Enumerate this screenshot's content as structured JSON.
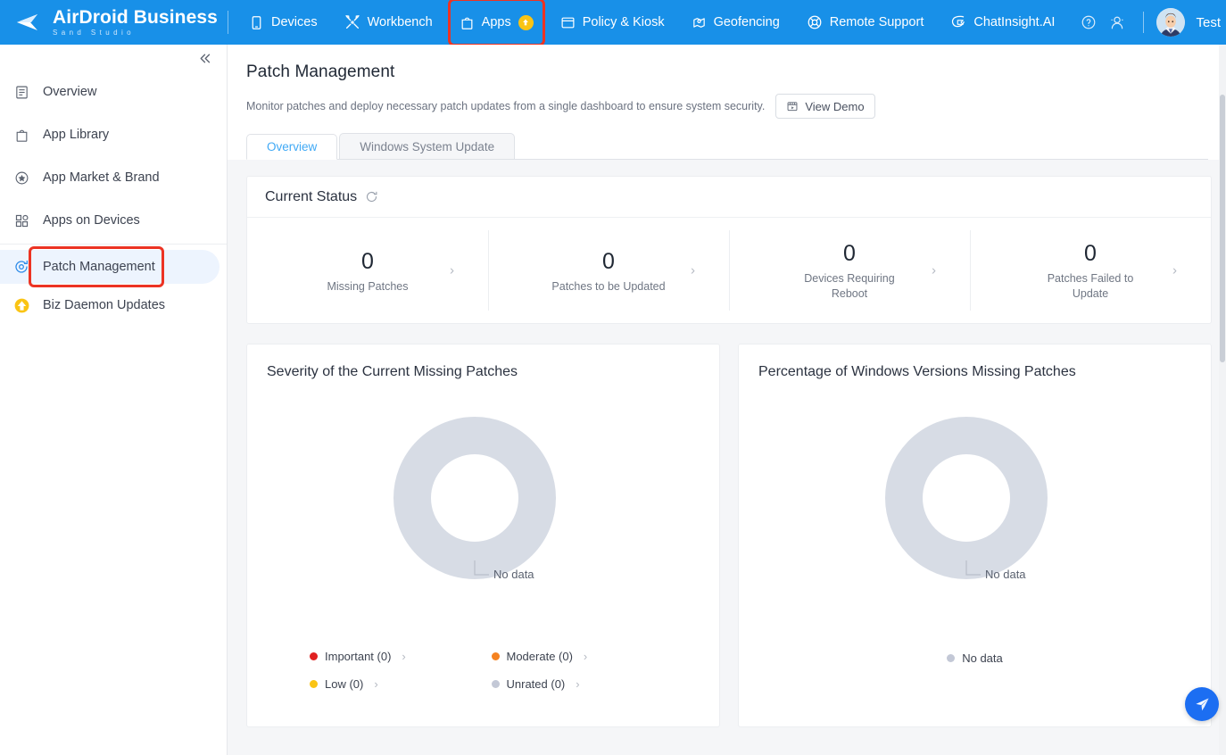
{
  "app": {
    "brand_name": "AirDroid Business",
    "brand_sub": "Sand Studio"
  },
  "topnav": {
    "items": [
      {
        "label": "Devices",
        "icon": "device-icon",
        "badge": null,
        "highlighted": false
      },
      {
        "label": "Workbench",
        "icon": "tools-icon",
        "badge": null,
        "highlighted": false
      },
      {
        "label": "Apps",
        "icon": "app-bag-icon",
        "badge": "upgrade-badge",
        "highlighted": true
      },
      {
        "label": "Policy & Kiosk",
        "icon": "folder-icon",
        "badge": null,
        "highlighted": false
      },
      {
        "label": "Geofencing",
        "icon": "map-pin-icon",
        "badge": null,
        "highlighted": false
      },
      {
        "label": "Remote Support",
        "icon": "lifebuoy-icon",
        "badge": null,
        "highlighted": false
      },
      {
        "label": "ChatInsight.AI",
        "icon": "chat-bubble-icon",
        "badge": null,
        "highlighted": false
      }
    ],
    "help_icon": "help-circle-icon",
    "account_icon": "user-circle-icon",
    "user_name": "Test",
    "highlight_color": "#ec3323",
    "bar_color": "#1890e8"
  },
  "sidebar": {
    "collapse_icon": "double-chevron-left-icon",
    "items": [
      {
        "label": "Overview",
        "icon": "document-lines-icon",
        "active": false,
        "highlighted": false
      },
      {
        "label": "App Library",
        "icon": "bag-icon",
        "active": false,
        "highlighted": false
      },
      {
        "label": "App Market & Brand",
        "icon": "star-circle-icon",
        "active": false,
        "highlighted": false
      },
      {
        "label": "Apps on Devices",
        "icon": "grid-squares-icon",
        "active": false,
        "highlighted": false
      },
      {
        "label": "Patch Management",
        "icon": "patch-refresh-icon",
        "active": true,
        "highlighted": true
      },
      {
        "label": "Biz Daemon Updates",
        "icon": "upgrade-arrow-icon",
        "active": false,
        "highlighted": false
      }
    ]
  },
  "page": {
    "title": "Patch Management",
    "description": "Monitor patches and deploy necessary patch updates from a single dashboard to ensure system security.",
    "demo_button": "View Demo",
    "demo_icon": "video-play-icon",
    "tabs": [
      {
        "label": "Overview",
        "active": true
      },
      {
        "label": "Windows System Update",
        "active": false
      }
    ]
  },
  "status_card": {
    "title": "Current Status",
    "refresh_icon": "refresh-icon",
    "stats": [
      {
        "value": "0",
        "label": "Missing Patches"
      },
      {
        "value": "0",
        "label": "Patches to be Updated"
      },
      {
        "value": "0",
        "label": "Devices Requiring Reboot"
      },
      {
        "value": "0",
        "label": "Patches Failed to Update"
      }
    ],
    "arrow_icon": "chevron-right-icon"
  },
  "chart_data": [
    {
      "type": "pie",
      "title": "Severity of the Current Missing Patches",
      "categories": [
        "No data"
      ],
      "values": [
        1
      ],
      "colors": [
        "#d7dce5"
      ],
      "annotations": [
        "No data"
      ],
      "empty_label": "No data",
      "legend_position": "bottom",
      "legend": [
        {
          "label": "Important (0)",
          "color": "#e02020",
          "value": 0
        },
        {
          "label": "Moderate (0)",
          "color": "#f58220",
          "value": 0
        },
        {
          "label": "Low (0)",
          "color": "#fac414",
          "value": 0
        },
        {
          "label": "Unrated (0)",
          "color": "#c3c8d6",
          "value": 0
        }
      ]
    },
    {
      "type": "pie",
      "title": "Percentage of Windows Versions Missing Patches",
      "categories": [
        "No data"
      ],
      "values": [
        1
      ],
      "colors": [
        "#d7dce5"
      ],
      "annotations": [
        "No data"
      ],
      "empty_label": "No data",
      "legend_position": "bottom",
      "legend": [
        {
          "label": "No data",
          "color": "#c3c8d6",
          "value": 0
        }
      ]
    }
  ],
  "fab": {
    "icon": "send-plane-icon",
    "color": "#1c6ef2"
  }
}
